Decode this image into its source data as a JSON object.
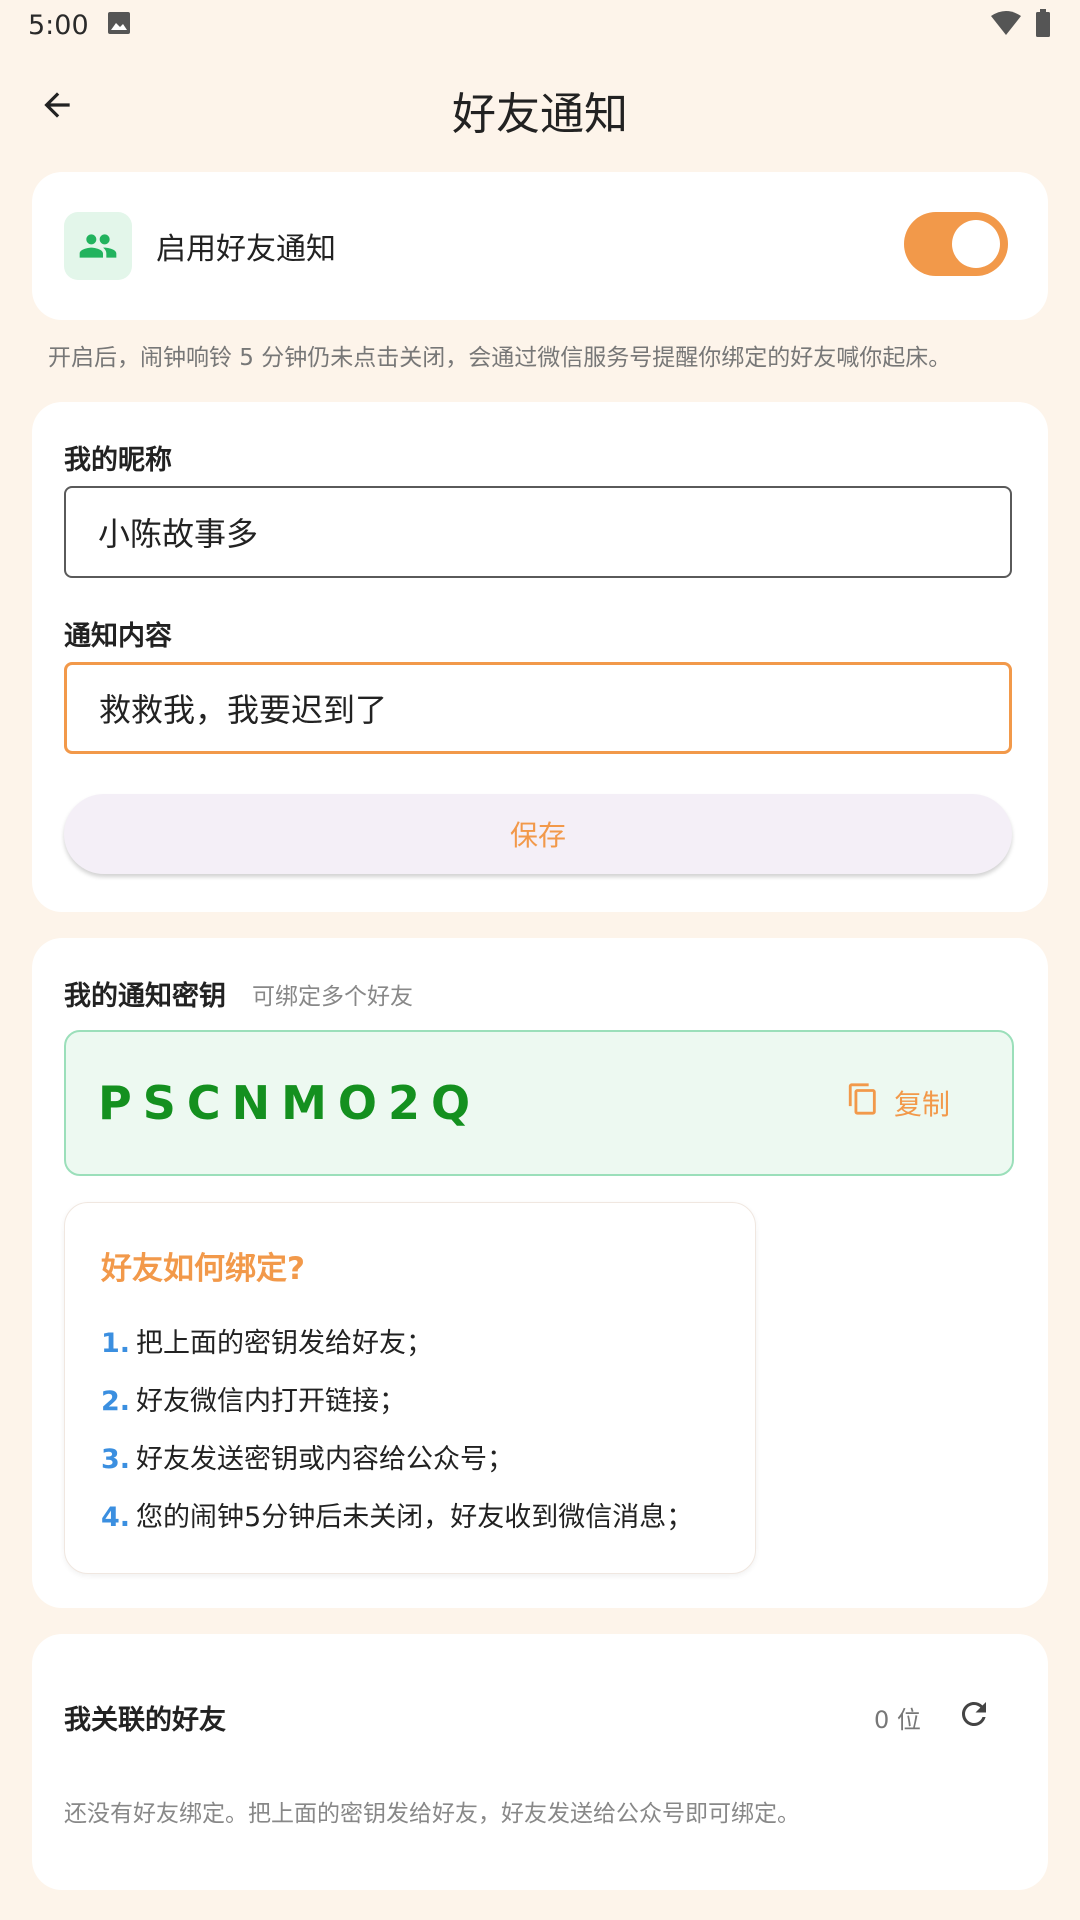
{
  "status_bar": {
    "time": "5:00",
    "icons": [
      "gallery-icon",
      "wifi-icon",
      "battery-icon"
    ]
  },
  "app_bar": {
    "title": "好友通知",
    "back_icon": "arrow-left-icon"
  },
  "toggle_card": {
    "icon": "people-icon",
    "label": "启用好友通知",
    "enabled": true
  },
  "helper_text": "开启后，闹钟响铃 5 分钟仍未点击关闭，会通过微信服务号提醒你绑定的好友喊你起床。",
  "form": {
    "nickname_label": "我的昵称",
    "nickname_value": "小陈故事多",
    "message_label": "通知内容",
    "message_value": "救救我，我要迟到了",
    "save_label": "保存"
  },
  "key_card": {
    "title": "我的通知密钥",
    "hint": "可绑定多个好友",
    "key": "PSCNMO2Q",
    "copy_label": "复制",
    "copy_icon": "copy-icon"
  },
  "howto": {
    "title": "好友如何绑定?",
    "steps": [
      {
        "num": "1.",
        "text": "把上面的密钥发给好友；"
      },
      {
        "num": "2.",
        "text": "好友微信内打开链接；"
      },
      {
        "num": "3.",
        "text": "好友发送密钥或内容给公众号；"
      },
      {
        "num": "4.",
        "text": "您的闹钟5分钟后未关闭，好友收到微信消息；"
      }
    ]
  },
  "friends_card": {
    "title": "我关联的好友",
    "count": "0 位",
    "refresh_icon": "refresh-icon",
    "empty_text": "还没有好友绑定。把上面的密钥发给好友，好友发送给公众号即可绑定。"
  },
  "colors": {
    "background": "#fdf4ea",
    "accent": "#f2994a",
    "key_green": "#14901f",
    "step_blue": "#3b8fe0",
    "icon_green": "#22b35e"
  }
}
